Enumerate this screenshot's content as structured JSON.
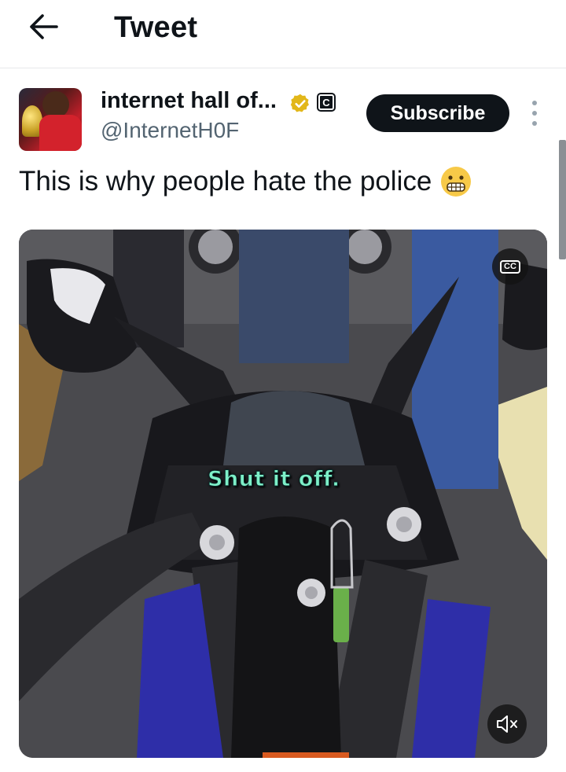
{
  "header": {
    "title": "Tweet",
    "back_icon": "arrow-left-icon"
  },
  "author": {
    "display_name": "internet hall of...",
    "handle": "@InternetH0F",
    "verified_badge_color": "#e2b719",
    "affiliate_icon": "C"
  },
  "actions": {
    "subscribe_label": "Subscribe",
    "more_icon": "vertical-dots-icon"
  },
  "tweet": {
    "text": "This is why people hate the police",
    "emoji": "grimacing-face"
  },
  "media": {
    "type": "video",
    "caption": "Shut it off.",
    "cc_label": "CC",
    "mute_icon": "speaker-muted-icon"
  },
  "colors": {
    "text": "#0f1419",
    "secondary": "#536471",
    "button_bg": "#0f1419",
    "caption": "#7ef0c8"
  }
}
